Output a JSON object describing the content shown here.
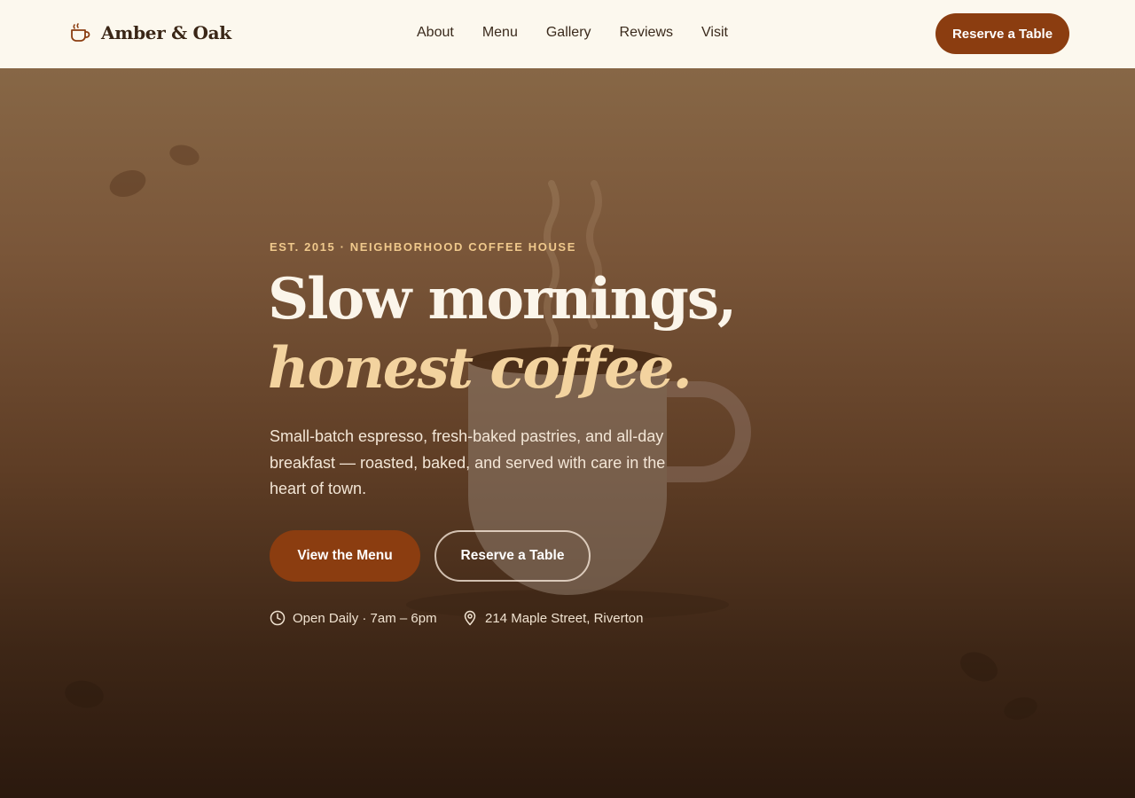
{
  "brand": {
    "name": "Amber & Oak",
    "icon": "coffee-cup-icon"
  },
  "nav": {
    "links": [
      "About",
      "Menu",
      "Gallery",
      "Reviews",
      "Visit"
    ],
    "cta_label": "Reserve a Table"
  },
  "hero": {
    "eyebrow": "EST. 2015 · NEIGHBORHOOD COFFEE HOUSE",
    "headline_line1": "Slow mornings,",
    "headline_line2": "honest coffee.",
    "lede": "Small-batch espresso, fresh-baked pastries, and all-day breakfast — roasted, baked, and served with care in the heart of town.",
    "primary_cta": "View the Menu",
    "secondary_cta": "Reserve a Table",
    "hours": "Open Daily · 7am – 6pm",
    "address": "214 Maple Street, Riverton"
  },
  "colors": {
    "accent": "#8b3d10",
    "nav_background": "#fcf8ee",
    "eyebrow": "#f0c98c",
    "headline_italic": "#f3d39f"
  }
}
